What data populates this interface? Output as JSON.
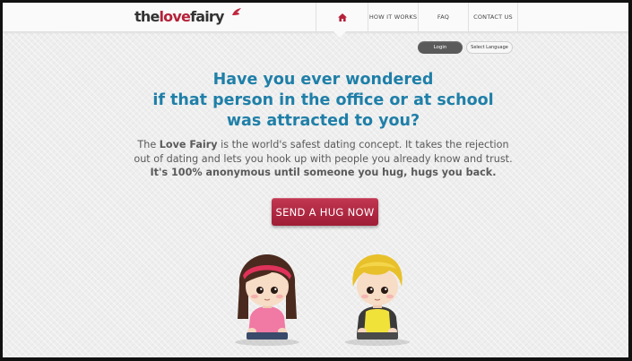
{
  "logo": {
    "part1": "the",
    "part2": "love",
    "part3": "fairy"
  },
  "nav": {
    "items": [
      {
        "label": "",
        "icon": "home-icon"
      },
      {
        "label": "HOW IT WORKS"
      },
      {
        "label": "FAQ"
      },
      {
        "label": "CONTACT US"
      }
    ]
  },
  "account": {
    "login_label": "Login",
    "language_label": "Select Language"
  },
  "hero": {
    "headline": [
      "Have you ever wondered",
      "if that person in the office or at school",
      "was attracted to you?"
    ],
    "desc_line1_pre": "The ",
    "desc_line1_bold": "Love Fairy",
    "desc_line1_post": " is the world's safest dating concept. It takes the rejection",
    "desc_line2": "out of dating and lets you hook up with people you already know and trust.",
    "desc_line3": "It's 100% anonymous until someone you hug, hugs you back.",
    "cta_label": "SEND A HUG NOW"
  },
  "colors": {
    "brand_red": "#b5223a",
    "headline_blue": "#1f7fa8",
    "cta_red": "#b0283f"
  }
}
